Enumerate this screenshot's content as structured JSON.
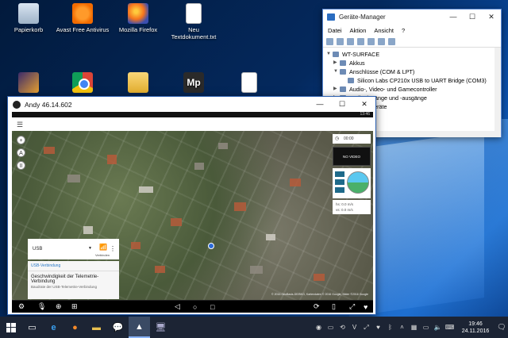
{
  "desktop": {
    "icons": [
      {
        "label": "Papierkorb",
        "icon": "recycle-bin-icon"
      },
      {
        "label": "Avast Free Antivirus",
        "icon": "avast-icon"
      },
      {
        "label": "Mozilla Firefox",
        "icon": "firefox-icon"
      },
      {
        "label": "Neu Textdokument.txt",
        "icon": "text-document-icon"
      },
      {
        "label": "",
        "icon": "pen-app-icon"
      },
      {
        "label": "",
        "icon": "chrome-icon"
      },
      {
        "label": "",
        "icon": "folder-icon"
      },
      {
        "label": "Mp",
        "icon": "mission-planner-icon"
      },
      {
        "label": "",
        "icon": "document-icon"
      }
    ]
  },
  "device_manager": {
    "title": "Geräte-Manager",
    "menu": [
      "Datei",
      "Aktion",
      "Ansicht",
      "?"
    ],
    "tree": [
      {
        "label": "WT-SURFACE",
        "level": 0,
        "expanded": true
      },
      {
        "label": "Akkus",
        "level": 1,
        "expanded": false
      },
      {
        "label": "Anschlüsse (COM & LPT)",
        "level": 1,
        "expanded": true
      },
      {
        "label": "Silicon Labs CP210x USB to UART Bridge (COM3)",
        "level": 2
      },
      {
        "label": "Audio-, Video- und Gamecontroller",
        "level": 1,
        "expanded": false
      },
      {
        "label": "Audioeingänge und -ausgänge",
        "level": 1,
        "expanded": false
      },
      {
        "label": "beitungsgeräte",
        "level": 1,
        "expanded": false
      }
    ]
  },
  "andy": {
    "title": "Andy 46.14.602",
    "status_time": "13:46",
    "map_controls": [
      "+",
      "A",
      "II"
    ],
    "usb_panel": {
      "connection": "USB",
      "status": "Verbinden"
    },
    "telemetry": {
      "header": "USB-Verbindung",
      "title": "Geschwindigkeit der Telemetrie-Verbindung",
      "subtitle": "Baudrate der USB-Telemetrie-Verbindung"
    },
    "right_panel": {
      "timer": "00:00",
      "video": "NO VIDEO AVAILABLE",
      "h_speed": "hs: 0.0 m/s",
      "v_speed": "vs: 0.0 m/s"
    },
    "map_attribution": "© 2016 GeoBasis-DE/BKG, Kartendaten © 2016 Google, Bilder ©2016 Google"
  },
  "taskbar": {
    "time": "19:46",
    "date": "24.11.2016"
  }
}
